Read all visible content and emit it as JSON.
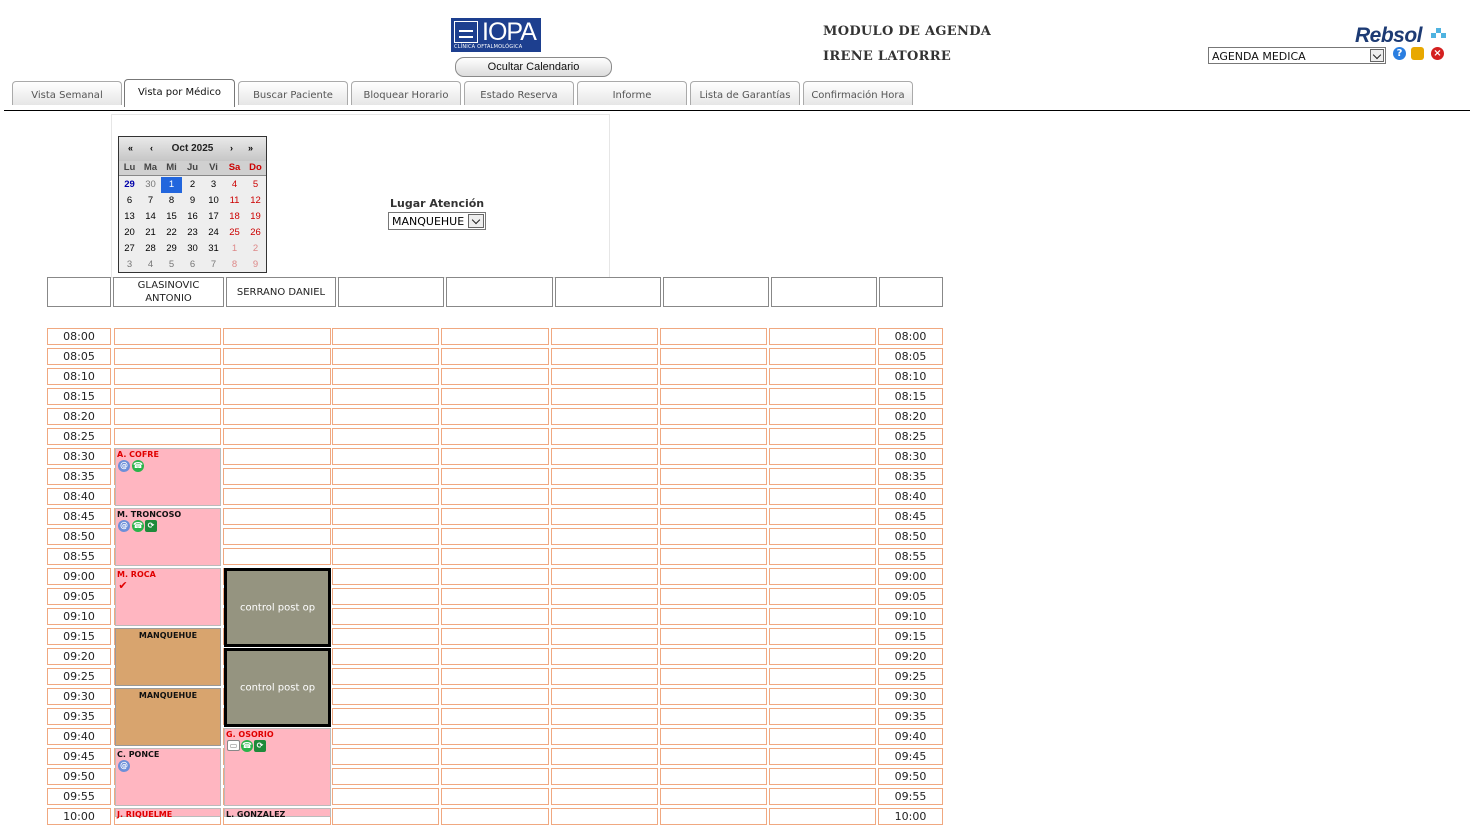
{
  "header": {
    "logo": {
      "name": "IOPA",
      "subtitle": "CLÍNICA OFTALMOLÓGICA"
    },
    "hide_calendar_label": "Ocultar Calendario",
    "module_title": "MODULO DE AGENDA",
    "user_name": "IRENE LATORRE",
    "brand": "Rebsol",
    "agenda_select": "AGENDA MEDICA",
    "help_icon": "?",
    "close_icon": "×"
  },
  "tabs": [
    {
      "label": "Vista Semanal",
      "active": false
    },
    {
      "label": "Vista por Médico",
      "active": true
    },
    {
      "label": "Buscar Paciente",
      "active": false
    },
    {
      "label": "Bloquear Horario",
      "active": false
    },
    {
      "label": "Estado Reserva",
      "active": false
    },
    {
      "label": "Informe",
      "active": false
    },
    {
      "label": "Lista de Garantías",
      "active": false
    },
    {
      "label": "Confirmación Hora",
      "active": false
    }
  ],
  "calendar": {
    "title": "Oct 2025",
    "nav": {
      "prev_year": "«",
      "prev_month": "‹",
      "next_month": "›",
      "next_year": "»"
    },
    "dow": [
      "Lu",
      "Ma",
      "Mi",
      "Ju",
      "Vi",
      "Sa",
      "Do"
    ],
    "weeks": [
      [
        "29",
        "30",
        "1",
        "2",
        "3",
        "4",
        "5"
      ],
      [
        "6",
        "7",
        "8",
        "9",
        "10",
        "11",
        "12"
      ],
      [
        "13",
        "14",
        "15",
        "16",
        "17",
        "18",
        "19"
      ],
      [
        "20",
        "21",
        "22",
        "23",
        "24",
        "25",
        "26"
      ],
      [
        "27",
        "28",
        "29",
        "30",
        "31",
        "1",
        "2"
      ],
      [
        "3",
        "4",
        "5",
        "6",
        "7",
        "8",
        "9"
      ]
    ]
  },
  "lugar": {
    "label": "Lugar Atención",
    "value": "MANQUEHUE"
  },
  "doctors": [
    "",
    "GLASINOVIC ANTONIO",
    "SERRANO DANIEL",
    "",
    "",
    "",
    "",
    "",
    ""
  ],
  "times": [
    "08:00",
    "08:05",
    "08:10",
    "08:15",
    "08:20",
    "08:25",
    "08:30",
    "08:35",
    "08:40",
    "08:45",
    "08:50",
    "08:55",
    "09:00",
    "09:05",
    "09:10",
    "09:15",
    "09:20",
    "09:25",
    "09:30",
    "09:35",
    "09:40",
    "09:45",
    "09:50",
    "09:55",
    "10:00"
  ],
  "appointments": {
    "glasinovic": [
      {
        "name": "A. COFRE",
        "icons": [
          "@",
          "☎"
        ]
      },
      {
        "name": "M. TRONCOSO",
        "icons": [
          "@",
          "☎",
          "⟳"
        ]
      },
      {
        "name": "M. ROCA",
        "icons": [
          "✔"
        ]
      },
      {
        "name": "MANQUEHUE"
      },
      {
        "name": "MANQUEHUE"
      },
      {
        "name": "C. PONCE",
        "icons": [
          "@"
        ]
      },
      {
        "name": "J. RIQUELME"
      }
    ],
    "serrano": [
      {
        "label": "control post op"
      },
      {
        "label": "control post op"
      },
      {
        "name": "G. OSORIO",
        "icons": [
          "▭",
          "☎",
          "⟳"
        ]
      },
      {
        "name": "L. GONZALEZ"
      }
    ]
  },
  "colors": {
    "slot_border": "#f0a880",
    "pink": "#ffb6c1",
    "tan": "#d8a46e",
    "gray": "#959480",
    "brand": "#1d3b74",
    "red_text": "#e00000"
  }
}
